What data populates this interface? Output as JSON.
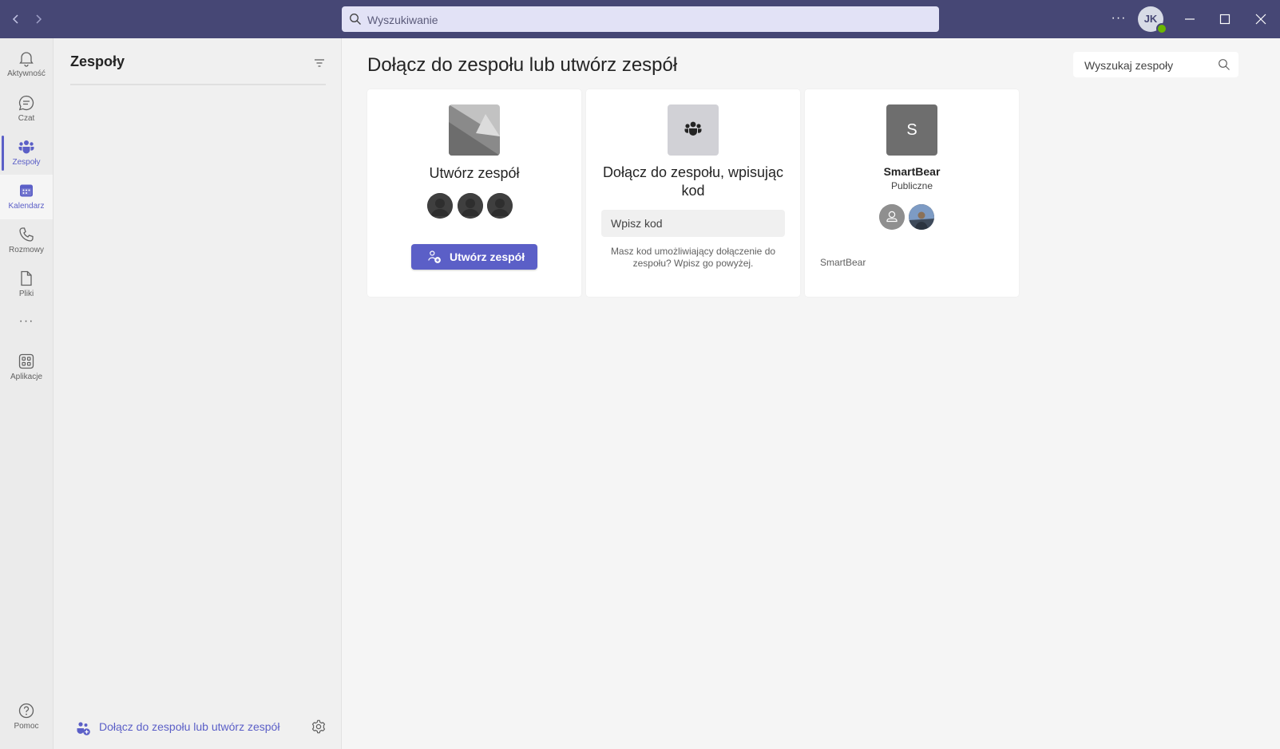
{
  "titlebar": {
    "back_icon": "chevron-left-icon",
    "forward_icon": "chevron-right-icon",
    "search_placeholder": "Wyszukiwanie",
    "more_label": "···",
    "avatar_initials": "JK",
    "presence_color": "#6bb700",
    "bg_color": "#464775"
  },
  "rail": {
    "items": [
      {
        "label": "Aktywność",
        "icon": "bell-icon"
      },
      {
        "label": "Czat",
        "icon": "chat-icon"
      },
      {
        "label": "Zespoły",
        "icon": "teams-icon",
        "active": true
      },
      {
        "label": "Kalendarz",
        "icon": "calendar-icon"
      },
      {
        "label": "Rozmowy",
        "icon": "phone-icon"
      },
      {
        "label": "Pliki",
        "icon": "file-icon"
      },
      {
        "label": "···",
        "icon": "more-icon"
      },
      {
        "label": "Aplikacje",
        "icon": "apps-icon"
      },
      {
        "label": "Pomoc",
        "icon": "help-icon"
      }
    ],
    "accent_color": "#5b5fc7"
  },
  "panel": {
    "title": "Zespoły",
    "join_link": "Dołącz do zespołu lub utwórz zespół"
  },
  "main": {
    "title": "Dołącz do zespołu lub utwórz zespół",
    "search_placeholder": "Wyszukaj zespoły",
    "cards": {
      "create": {
        "title": "Utwórz zespół",
        "button_label": "Utwórz zespół"
      },
      "join_code": {
        "title": "Dołącz do zespołu, wpisując kod",
        "input_placeholder": "Wpisz kod",
        "help_text": "Masz kod umożliwiający dołączenie do zespołu? Wpisz go powyżej."
      },
      "team": {
        "initial": "S",
        "name": "SmartBear",
        "privacy": "Publiczne",
        "footer": "SmartBear"
      }
    }
  }
}
